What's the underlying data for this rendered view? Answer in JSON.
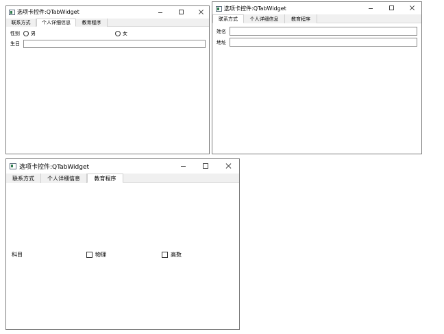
{
  "window_title": "选项卡控件:QTabWidget",
  "tabs": [
    "联系方式",
    "个人详细信息",
    "教育程序"
  ],
  "win1": {
    "gender_label": "性别",
    "male": "男",
    "female": "女",
    "birthday_label": "生日",
    "birthday_value": ""
  },
  "win2": {
    "name_label": "姓名",
    "name_value": "",
    "address_label": "地址",
    "address_value": ""
  },
  "win3": {
    "subject_label": "科目",
    "physics": "物理",
    "math": "高数"
  }
}
